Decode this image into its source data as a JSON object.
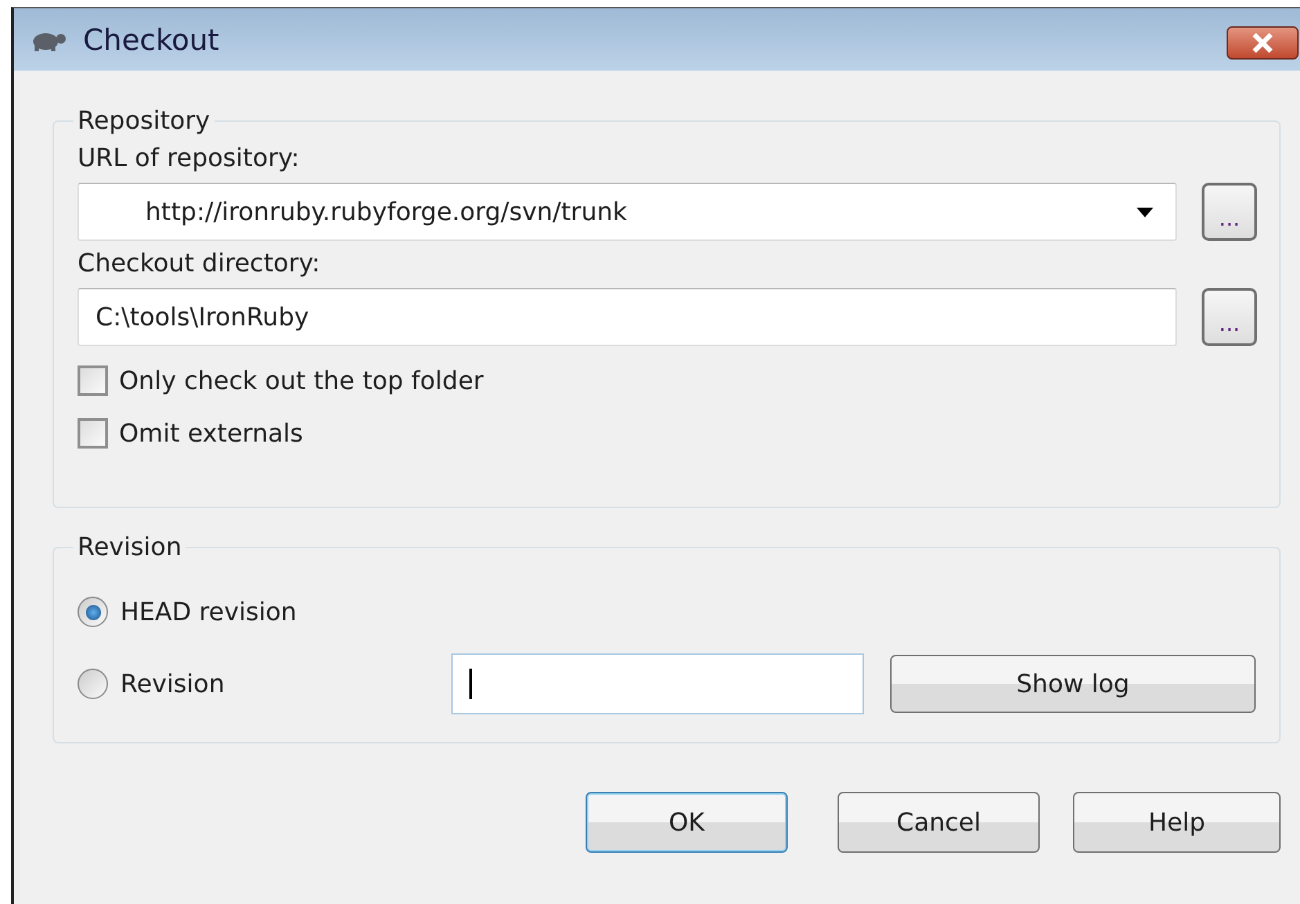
{
  "window": {
    "title": "Checkout"
  },
  "repository": {
    "title": "Repository",
    "url_label": "URL of repository:",
    "url_value": "http://ironruby.rubyforge.org/svn/trunk",
    "url_browse": "...",
    "dir_label": "Checkout directory:",
    "dir_value": "C:\\tools\\IronRuby",
    "dir_browse": "...",
    "options": [
      {
        "label": "Only check out the top folder",
        "checked": false
      },
      {
        "label": "Omit externals",
        "checked": false
      }
    ]
  },
  "revision": {
    "title": "Revision",
    "choices": [
      {
        "label": "HEAD revision",
        "selected": true
      },
      {
        "label": "Revision",
        "selected": false
      }
    ],
    "show_log": "Show log"
  },
  "buttons": [
    {
      "label": "OK",
      "default": true
    },
    {
      "label": "Cancel",
      "default": false
    },
    {
      "label": "Help",
      "default": false
    }
  ]
}
